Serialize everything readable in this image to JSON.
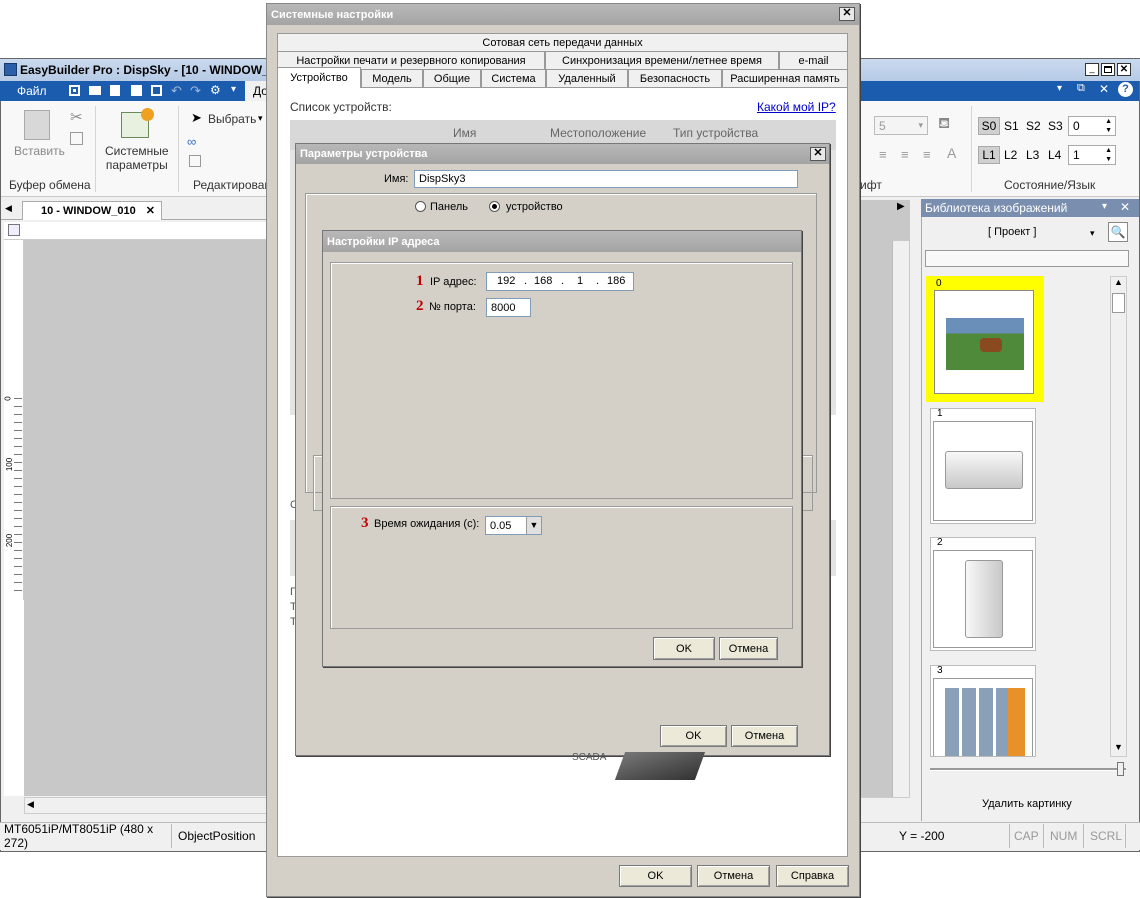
{
  "main_window": {
    "title": "EasyBuilder Pro : DispSky - [10 - WINDOW_01",
    "menu_file": "Файл",
    "menu_partial": "До",
    "ribbon": {
      "paste": "Вставить",
      "clipboard_group": "Буфер обмена",
      "system_params": "Системные\nпараметры",
      "select": "Выбрать",
      "edit_group": "Редактирован",
      "font_size": "5",
      "font_group": "ифт",
      "state_buttons": [
        "S0",
        "S1",
        "S2",
        "S3"
      ],
      "state_value": "0",
      "lang_buttons": [
        "L1",
        "L2",
        "L3",
        "L4"
      ],
      "lang_value": "1",
      "state_group": "Состояние/Язык"
    },
    "doc_tab": "10 - WINDOW_010",
    "ruler_marks": [
      "0",
      "100",
      "200"
    ],
    "status": {
      "model": "MT6051iP/MT8051iP (480 x 272)",
      "object": "ObjectPosition",
      "y": "Y = -200",
      "cap": "CAP",
      "num": "NUM",
      "scrl": "SCRL"
    },
    "library": {
      "title": "Библиотека изображений",
      "project": "[ Проект ]",
      "items": [
        "0",
        "1",
        "2",
        "3"
      ],
      "delete": "Удалить картинку"
    },
    "bg_text_scada": "SCADA"
  },
  "system_dialog": {
    "title": "Системные настройки",
    "tabs_row1": [
      "Сотовая сеть передачи данных"
    ],
    "tabs_row2": [
      "Настройки печати и резервного копирования",
      "Синхронизация времени/летнее время",
      "e-mail"
    ],
    "tabs_row3": [
      "Устройство",
      "Модель",
      "Общие",
      "Система",
      "Удаленный",
      "Безопасность",
      "Расширенная память"
    ],
    "device_list_label": "Список устройств:",
    "my_ip_link": "Какой мой IP?",
    "columns": [
      "Имя",
      "Местоположение",
      "Тип устройства"
    ],
    "side_letters": [
      "С",
      "Г",
      "Т",
      "Т"
    ],
    "ok": "OK",
    "cancel": "Отмена",
    "help": "Справка"
  },
  "device_dialog": {
    "title": "Параметры устройства",
    "name_label": "Имя:",
    "name_value": "DispSky3",
    "radio_panel": "Панель",
    "radio_device": "устройство",
    "ok": "OK",
    "cancel": "Отмена"
  },
  "ip_dialog": {
    "title": "Настройки IP адреса",
    "step1": "1",
    "ip_label": "IP адрес:",
    "ip": [
      "192",
      "168",
      "1",
      "186"
    ],
    "step2": "2",
    "port_label": "№ порта:",
    "port_value": "8000",
    "step3": "3",
    "timeout_label": "Время ожидания (с):",
    "timeout_value": "0.05",
    "ok": "OK",
    "cancel": "Отмена"
  }
}
